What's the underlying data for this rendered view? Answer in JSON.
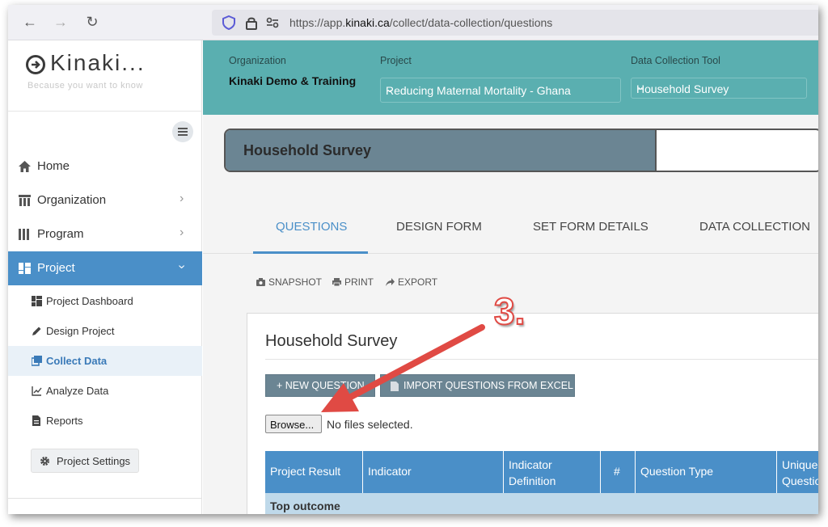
{
  "browser": {
    "url_prefix": "https://app.",
    "url_domain": "kinaki.ca",
    "url_path": "/collect/data-collection/questions"
  },
  "logo": {
    "name": "Kinaki...",
    "tagline": "Because you want to know"
  },
  "sidebar": {
    "items": [
      {
        "label": "Home",
        "icon": "home-icon"
      },
      {
        "label": "Organization",
        "icon": "org-icon"
      },
      {
        "label": "Program",
        "icon": "program-icon"
      },
      {
        "label": "Project",
        "icon": "project-icon"
      }
    ],
    "sub_items": [
      {
        "label": "Project Dashboard",
        "icon": "dashboard-icon"
      },
      {
        "label": "Design Project",
        "icon": "pencil-icon"
      },
      {
        "label": "Collect Data",
        "icon": "collect-icon"
      },
      {
        "label": "Analyze Data",
        "icon": "chart-icon"
      },
      {
        "label": "Reports",
        "icon": "report-icon"
      }
    ],
    "settings_label": "Project Settings"
  },
  "header": {
    "org_label": "Organization",
    "org_value": "Kinaki Demo & Training",
    "project_label": "Project",
    "project_value": "Reducing Maternal Mortality - Ghana",
    "tool_label": "Data Collection Tool",
    "tool_value": "Household Survey"
  },
  "main": {
    "title": "Household Survey",
    "tabs": [
      "QUESTIONS",
      "DESIGN FORM",
      "SET FORM DETAILS",
      "DATA COLLECTION"
    ],
    "actions": [
      "SNAPSHOT",
      "PRINT",
      "EXPORT"
    ],
    "panel_title": "Household Survey",
    "new_question": "+ NEW QUESTION",
    "import_excel": "IMPORT QUESTIONS FROM EXCEL",
    "browse": "Browse...",
    "no_files": "No files selected.",
    "table_headers": [
      "Project Result",
      "Indicator",
      "Indicator Definition",
      "#",
      "Question Type",
      "Unique Question"
    ],
    "subhead": "Top outcome"
  },
  "annotation": {
    "step": "3.",
    "color": "#e04a44"
  },
  "colors": {
    "accent": "#4a8fc8",
    "header_teal": "#5aafb0",
    "slate": "#6b8593"
  }
}
